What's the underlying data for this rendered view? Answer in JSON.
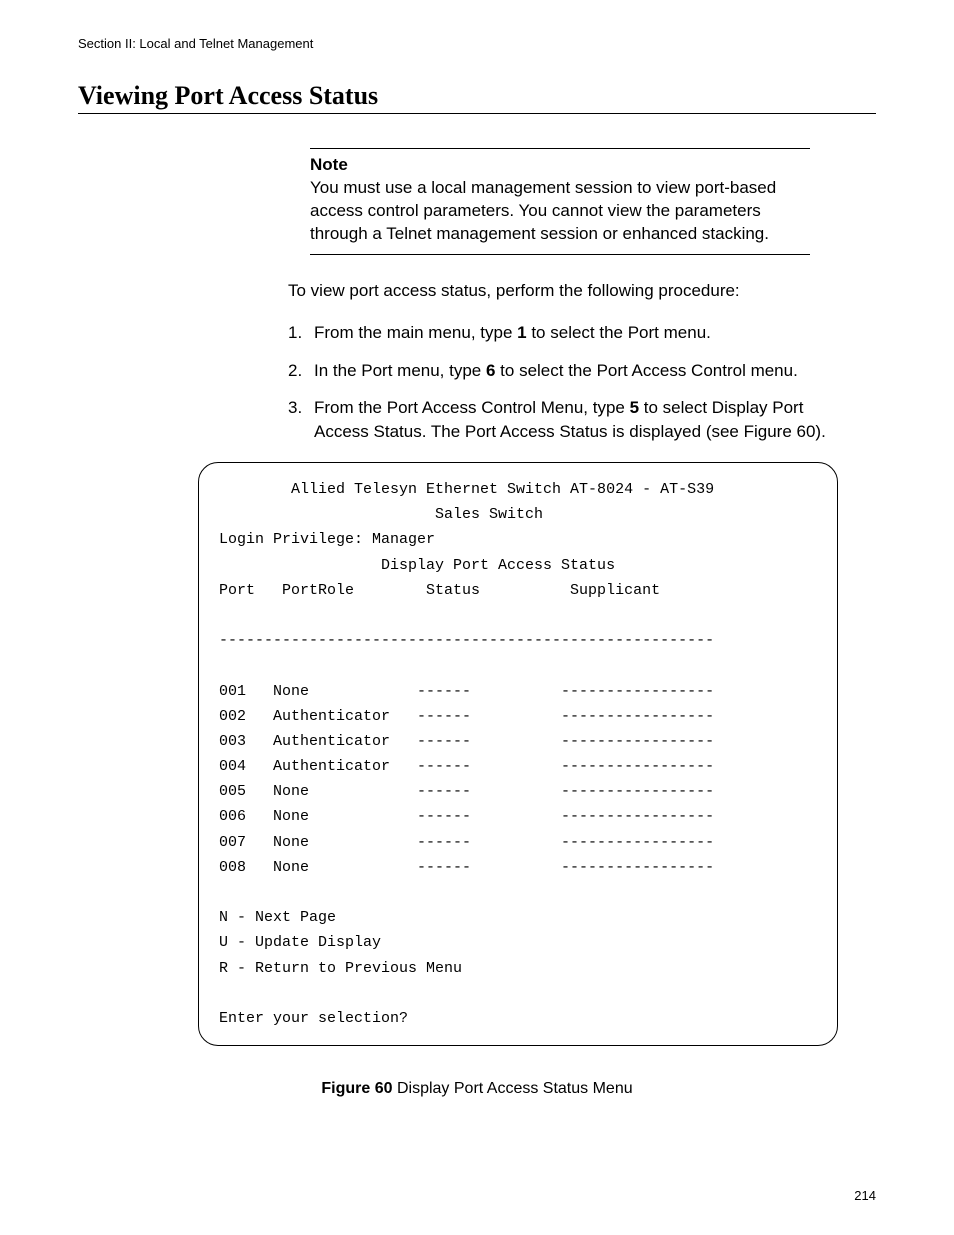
{
  "runningHeader": "Section II: Local and Telnet Management",
  "heading": "Viewing Port Access Status",
  "note": {
    "label": "Note",
    "body": "You must use a local management session to view port-based access control parameters. You cannot view the parameters through a Telnet management session or enhanced stacking."
  },
  "intro": "To view port access status, perform the following procedure:",
  "steps": [
    {
      "num": "1.",
      "pre": "From the main menu, type ",
      "bold": "1",
      "post": " to select the Port menu."
    },
    {
      "num": "2.",
      "pre": "In the Port menu, type ",
      "bold": "6",
      "post": " to select the Port Access Control menu."
    },
    {
      "num": "3.",
      "pre": "From the Port Access Control Menu, type ",
      "bold": "5",
      "post": " to select Display Port Access Status. The Port Access Status is displayed (see Figure 60)."
    }
  ],
  "terminal": {
    "title1": "Allied Telesyn Ethernet Switch AT-8024 - AT-S39",
    "title2": "Sales Switch",
    "login": "Login Privilege: Manager",
    "screenTitle": "Display Port Access Status",
    "cols": {
      "c1": "Port",
      "c2": "PortRole",
      "c3": "Status",
      "c4": "Supplicant"
    },
    "sep": "-------------------------------------------------------",
    "rows": [
      {
        "c1": "001",
        "c2": "None",
        "c3": "------",
        "c4": "-----------------"
      },
      {
        "c1": "002",
        "c2": "Authenticator",
        "c3": "------",
        "c4": "-----------------"
      },
      {
        "c1": "003",
        "c2": "Authenticator",
        "c3": "------",
        "c4": "-----------------"
      },
      {
        "c1": "004",
        "c2": "Authenticator",
        "c3": "------",
        "c4": "-----------------"
      },
      {
        "c1": "005",
        "c2": "None",
        "c3": "------",
        "c4": "-----------------"
      },
      {
        "c1": "006",
        "c2": "None",
        "c3": "------",
        "c4": "-----------------"
      },
      {
        "c1": "007",
        "c2": "None",
        "c3": "------",
        "c4": "-----------------"
      },
      {
        "c1": "008",
        "c2": "None",
        "c3": "------",
        "c4": "-----------------"
      }
    ],
    "menu": [
      "N - Next Page",
      "U - Update Display",
      "R - Return to Previous Menu"
    ],
    "prompt": "Enter your selection?"
  },
  "figure": {
    "label": "Figure 60",
    "caption": "  Display Port Access Status Menu"
  },
  "pageNumber": "214"
}
